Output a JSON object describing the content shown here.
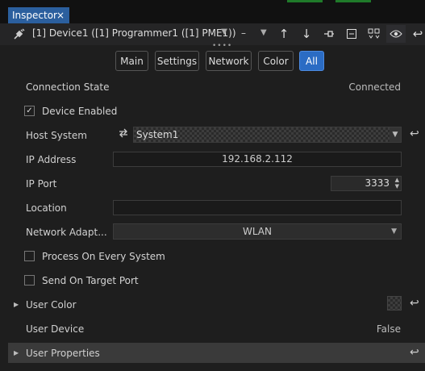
{
  "panel": {
    "title": "Inspector",
    "close_icon": "×"
  },
  "toolbar": {
    "device_label": "[1] Device1 ([1] Programmer1 ([1] PME1))",
    "dash_label": "–",
    "dots": "••••"
  },
  "tabs": [
    {
      "label": "Main",
      "selected": false
    },
    {
      "label": "Settings",
      "selected": false
    },
    {
      "label": "Network",
      "selected": false
    },
    {
      "label": "Color",
      "selected": false
    },
    {
      "label": "All",
      "selected": true
    }
  ],
  "properties": {
    "connection_state_label": "Connection State",
    "connection_state_value": "Connected",
    "device_enabled_label": "Device Enabled",
    "device_enabled_checked": true,
    "host_system_label": "Host System",
    "host_system_value": "System1",
    "ip_address_label": "IP Address",
    "ip_address_value": "192.168.2.112",
    "ip_port_label": "IP Port",
    "ip_port_value": "3333",
    "location_label": "Location",
    "location_value": "",
    "network_adapter_label": "Network Adapt...",
    "network_adapter_value": "WLAN",
    "process_every_label": "Process On Every System",
    "process_every_checked": false,
    "send_target_label": "Send On Target Port",
    "send_target_checked": false,
    "user_color_label": "User Color",
    "user_device_label": "User Device",
    "user_device_value": "False",
    "user_properties_label": "User Properties"
  },
  "colors": {
    "accent": "#2b6cc4",
    "tab": "#2b5f9e",
    "background": "#1e1e1e"
  }
}
